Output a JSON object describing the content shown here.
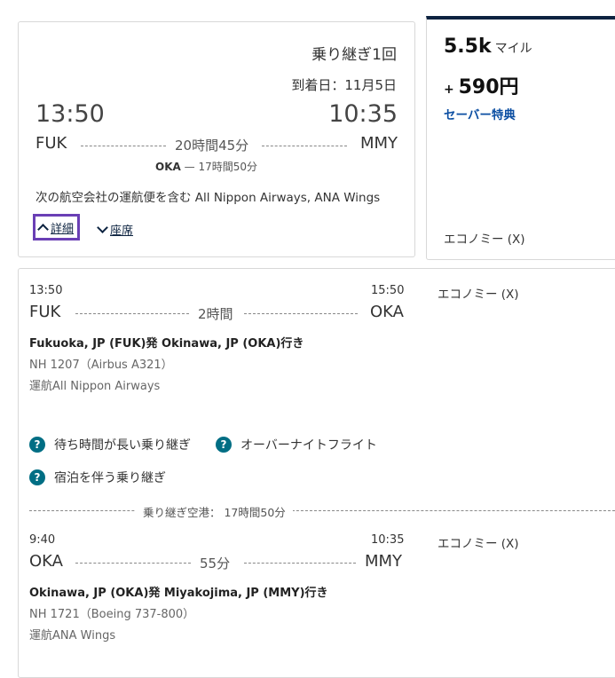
{
  "summary": {
    "stops": "乗り継ぎ1回",
    "arrival_date": "到着日：11月5日",
    "depart_time": "13:50",
    "arrive_time": "10:35",
    "origin": "FUK",
    "destination": "MMY",
    "duration": "20時間45分",
    "via_code": "OKA",
    "via_duration": "— 17時間50分",
    "operated_by": "次の航空会社の運航便を含む All Nippon Airways, ANA Wings",
    "details_label": "詳細",
    "seats_label": "座席"
  },
  "fare": {
    "miles": "5.5k",
    "miles_unit": "マイル",
    "tax": "590円",
    "fare_type": "セーバー特典",
    "cabin": "エコノミー (X)"
  },
  "segments": [
    {
      "depart_time": "13:50",
      "arrive_time": "15:50",
      "origin": "FUK",
      "destination": "OKA",
      "duration": "2時間",
      "cabin": "エコノミー (X)",
      "route": "Fukuoka, JP (FUK)発 Okinawa, JP (OKA)行き",
      "flight": "NH 1207（Airbus A321）",
      "operator": "運航All Nippon Airways"
    },
    {
      "depart_time": "9:40",
      "arrive_time": "10:35",
      "origin": "OKA",
      "destination": "MMY",
      "duration": "55分",
      "cabin": "エコノミー (X)",
      "route": "Okinawa, JP (OKA)発 Miyakojima, JP (MMY)行き",
      "flight": "NH 1721（Boeing 737-800）",
      "operator": "運航ANA Wings"
    }
  ],
  "warnings": {
    "long_layover": "待ち時間が長い乗り継ぎ",
    "overnight": "オーバーナイトフライト",
    "overnight_stay": "宿泊を伴う乗り継ぎ",
    "icon": "?"
  },
  "layover": {
    "text": "乗り継ぎ空港： 17時間50分"
  },
  "colors": {
    "accent_navy": "#0c2340",
    "link_blue": "#0b4ea2",
    "info_teal": "#006e84",
    "focus_purple": "#6a3fb5"
  }
}
